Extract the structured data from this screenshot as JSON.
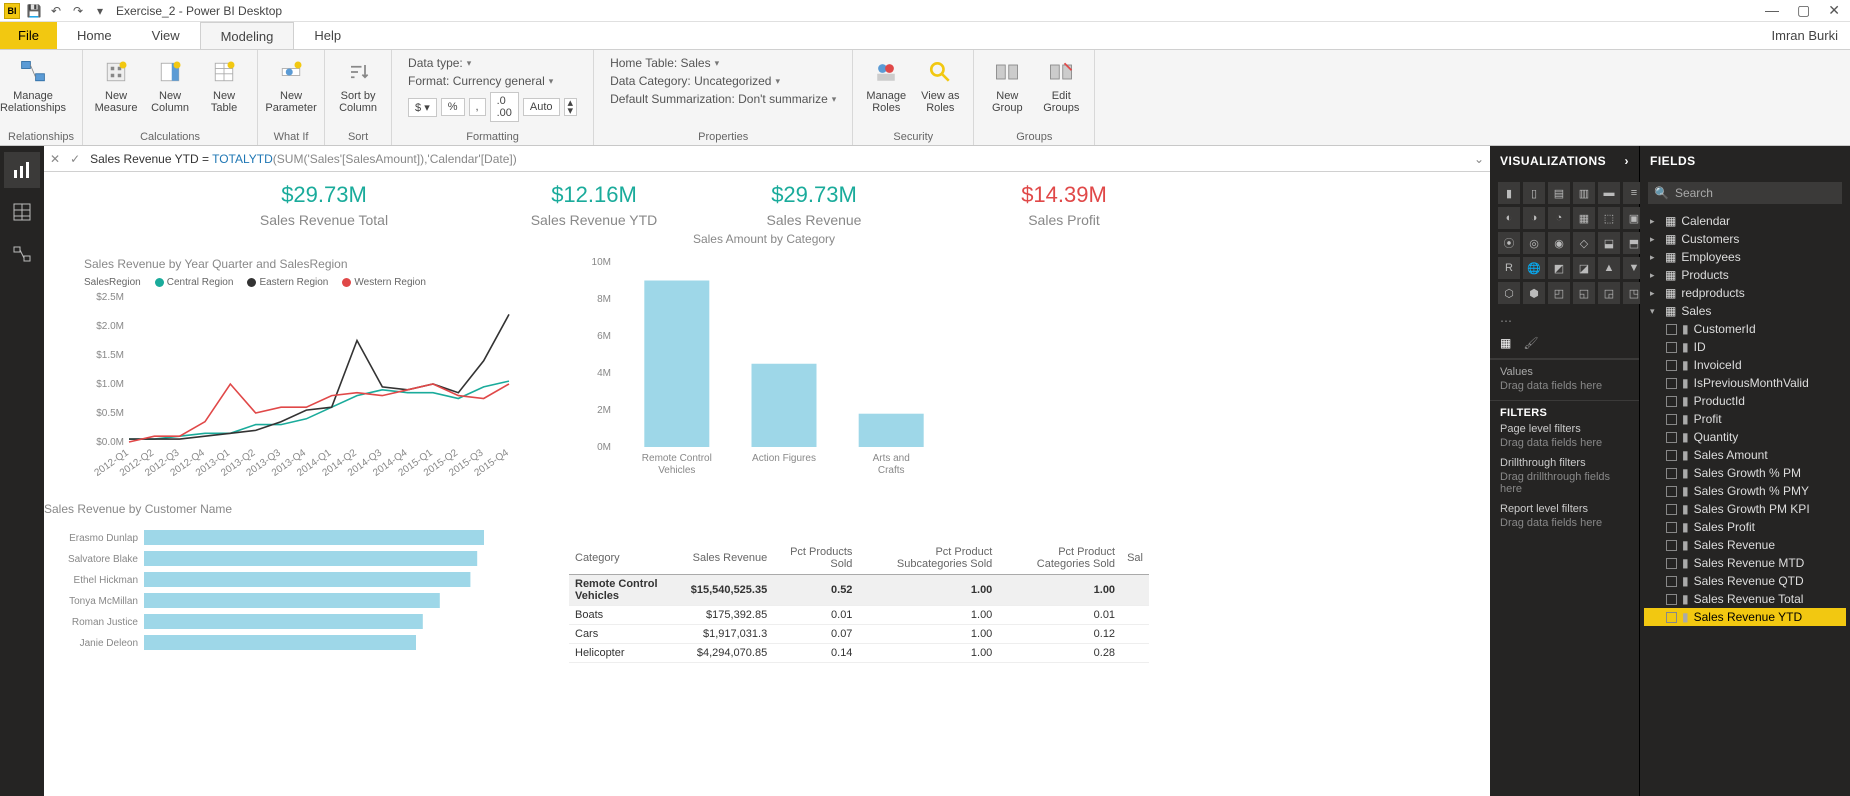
{
  "title": "Exercise_2 - Power BI Desktop",
  "user": "Imran Burki",
  "menu": {
    "file": "File",
    "tabs": [
      "Home",
      "View",
      "Modeling",
      "Help"
    ],
    "active": "Modeling"
  },
  "ribbon": {
    "relationships": {
      "manage": "Manage\nRelationships",
      "label": "Relationships"
    },
    "calculations": {
      "measure": "New\nMeasure",
      "column": "New\nColumn",
      "table": "New\nTable",
      "label": "Calculations"
    },
    "whatif": {
      "param": "New\nParameter",
      "label": "What If"
    },
    "sort": {
      "sortby": "Sort by\nColumn",
      "label": "Sort"
    },
    "formatting": {
      "datatype": "Data type:",
      "format": "Format: Currency general",
      "auto": "Auto",
      "label": "Formatting"
    },
    "properties": {
      "hometable": "Home Table: Sales",
      "datacat": "Data Category: Uncategorized",
      "summ": "Default Summarization: Don't summarize",
      "label": "Properties"
    },
    "security": {
      "roles": "Manage\nRoles",
      "viewas": "View as\nRoles",
      "label": "Security"
    },
    "groups": {
      "new": "New\nGroup",
      "edit": "Edit\nGroups",
      "label": "Groups"
    }
  },
  "formula": {
    "measure": "Sales Revenue YTD",
    "eq": " = ",
    "fn": "TOTALYTD",
    "args": "(SUM('Sales'[SalesAmount]),'Calendar'[Date])"
  },
  "kpis": [
    {
      "value": "$29.73M",
      "label": "Sales Revenue Total",
      "cls": "teal"
    },
    {
      "value": "$12.16M",
      "label": "Sales Revenue YTD",
      "cls": "teal"
    },
    {
      "value": "$29.73M",
      "label": "Sales Revenue",
      "cls": "teal"
    },
    {
      "value": "$14.39M",
      "label": "Sales Profit",
      "cls": "red"
    }
  ],
  "lineChart": {
    "title": "Sales Revenue by Year Quarter and SalesRegion",
    "legendLabel": "SalesRegion",
    "legend": [
      {
        "name": "Central Region",
        "color": "#1aab9b"
      },
      {
        "name": "Eastern Region",
        "color": "#333333"
      },
      {
        "name": "Western Region",
        "color": "#e04848"
      }
    ],
    "yticks": [
      "$0.0M",
      "$0.5M",
      "$1.0M",
      "$1.5M",
      "$2.0M",
      "$2.5M"
    ],
    "xticks": [
      "2012-Q1",
      "2012-Q2",
      "2012-Q3",
      "2012-Q4",
      "2013-Q1",
      "2013-Q2",
      "2013-Q3",
      "2013-Q4",
      "2014-Q1",
      "2014-Q2",
      "2014-Q3",
      "2014-Q4",
      "2015-Q1",
      "2015-Q2",
      "2015-Q3",
      "2015-Q4"
    ]
  },
  "barChart": {
    "title": "Sales Amount by Category",
    "yticks": [
      "0M",
      "2M",
      "4M",
      "6M",
      "8M",
      "10M"
    ],
    "categories": [
      "Remote Control Vehicles",
      "Action Figures",
      "Arts and Crafts"
    ]
  },
  "hbarChart": {
    "title": "Sales Revenue by Customer Name",
    "names": [
      "Erasmo Dunlap",
      "Salvatore Blake",
      "Ethel Hickman",
      "Tonya McMillan",
      "Roman Justice",
      "Janie Deleon"
    ]
  },
  "table": {
    "cols": [
      "Category",
      "Sales Revenue",
      "Pct Products Sold",
      "Pct Product Subcategories Sold",
      "Pct Product Categories Sold",
      "Sal"
    ],
    "rows": [
      [
        "Remote Control Vehicles",
        "$15,540,525.35",
        "0.52",
        "1.00",
        "1.00",
        ""
      ],
      [
        "Boats",
        "$175,392.85",
        "0.01",
        "1.00",
        "0.01",
        ""
      ],
      [
        "Cars",
        "$1,917,031.3",
        "0.07",
        "1.00",
        "0.12",
        ""
      ],
      [
        "Helicopter",
        "$4,294,070.85",
        "0.14",
        "1.00",
        "0.28",
        ""
      ]
    ]
  },
  "vizPane": {
    "header": "VISUALIZATIONS",
    "values": "Values",
    "dragValues": "Drag data fields here",
    "filters": "FILTERS",
    "pageFilters": "Page level filters",
    "dragPage": "Drag data fields here",
    "drill": "Drillthrough filters",
    "dragDrill": "Drag drillthrough fields here",
    "report": "Report level filters",
    "dragReport": "Drag data fields here"
  },
  "fieldsPane": {
    "header": "FIELDS",
    "search": "Search",
    "tables": [
      "Calendar",
      "Customers",
      "Employees",
      "Products",
      "redproducts"
    ],
    "openTable": "Sales",
    "fields": [
      "CustomerId",
      "ID",
      "InvoiceId",
      "IsPreviousMonthValid",
      "ProductId",
      "Profit",
      "Quantity",
      "Sales Amount",
      "Sales Growth % PM",
      "Sales Growth % PMY",
      "Sales Growth PM KPI",
      "Sales Profit",
      "Sales Revenue",
      "Sales Revenue MTD",
      "Sales Revenue QTD",
      "Sales Revenue Total",
      "Sales Revenue YTD"
    ],
    "selected": "Sales Revenue YTD"
  },
  "chart_data": [
    {
      "type": "line",
      "title": "Sales Revenue by Year Quarter and SalesRegion",
      "xlabel": "",
      "ylabel": "",
      "ylim": [
        0,
        2.5
      ],
      "x": [
        "2012-Q1",
        "2012-Q2",
        "2012-Q3",
        "2012-Q4",
        "2013-Q1",
        "2013-Q2",
        "2013-Q3",
        "2013-Q4",
        "2014-Q1",
        "2014-Q2",
        "2014-Q3",
        "2014-Q4",
        "2015-Q1",
        "2015-Q2",
        "2015-Q3",
        "2015-Q4"
      ],
      "series": [
        {
          "name": "Central Region",
          "color": "#1aab9b",
          "values": [
            0.05,
            0.05,
            0.1,
            0.15,
            0.15,
            0.3,
            0.3,
            0.4,
            0.6,
            0.8,
            0.9,
            0.85,
            0.85,
            0.75,
            0.95,
            1.05
          ]
        },
        {
          "name": "Eastern Region",
          "color": "#333333",
          "values": [
            0.05,
            0.05,
            0.05,
            0.1,
            0.15,
            0.2,
            0.35,
            0.55,
            0.6,
            1.75,
            0.95,
            0.9,
            1.0,
            0.85,
            1.4,
            2.2
          ]
        },
        {
          "name": "Western Region",
          "color": "#e04848",
          "values": [
            0.0,
            0.1,
            0.1,
            0.35,
            1.0,
            0.5,
            0.6,
            0.6,
            0.8,
            0.85,
            0.8,
            0.9,
            1.0,
            0.8,
            0.75,
            1.0
          ]
        }
      ]
    },
    {
      "type": "bar",
      "title": "Sales Amount by Category",
      "ylim": [
        0,
        10
      ],
      "categories": [
        "Remote Control Vehicles",
        "Action Figures",
        "Arts and Crafts"
      ],
      "values": [
        9.0,
        4.5,
        1.8
      ]
    },
    {
      "type": "bar",
      "orientation": "horizontal",
      "title": "Sales Revenue by Customer Name",
      "categories": [
        "Erasmo Dunlap",
        "Salvatore Blake",
        "Ethel Hickman",
        "Tonya McMillan",
        "Roman Justice",
        "Janie Deleon"
      ],
      "values": [
        100,
        98,
        96,
        87,
        82,
        80
      ]
    },
    {
      "type": "table",
      "columns": [
        "Category",
        "Sales Revenue",
        "Pct Products Sold",
        "Pct Product Subcategories Sold",
        "Pct Product Categories Sold"
      ],
      "rows": [
        [
          "Remote Control Vehicles",
          15540525.35,
          0.52,
          1.0,
          1.0
        ],
        [
          "Boats",
          175392.85,
          0.01,
          1.0,
          0.01
        ],
        [
          "Cars",
          1917031.3,
          0.07,
          1.0,
          0.12
        ],
        [
          "Helicopter",
          4294070.85,
          0.14,
          1.0,
          0.28
        ]
      ]
    }
  ]
}
